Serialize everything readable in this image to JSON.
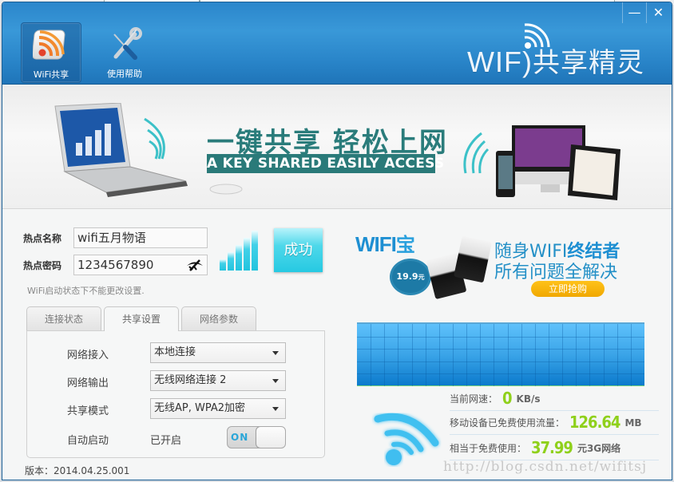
{
  "window": {
    "minimize_label": "—",
    "close_label": "✕"
  },
  "nav": {
    "items": [
      {
        "label": "WiFi共享",
        "icon": "rss-wifi-icon",
        "active": true
      },
      {
        "label": "使用帮助",
        "icon": "tools-icon",
        "active": false
      }
    ]
  },
  "logo": {
    "text_en": "WIF",
    "text_cn": "共享精灵"
  },
  "banner": {
    "slogan_cn": "一键共享 轻松上网",
    "slogan_en": "A KEY SHARED EASILY ACCESS"
  },
  "hotspot": {
    "name_label": "热点名称",
    "name_value": "wifi五月物语",
    "password_label": "热点密码",
    "password_value": "1234567890",
    "hint": "WiFi启动状态下不能更改设置.",
    "status_button": "成功",
    "signal_bars": 5
  },
  "tabs": [
    {
      "label": "连接状态",
      "active": false
    },
    {
      "label": "共享设置",
      "active": true
    },
    {
      "label": "网络参数",
      "active": false
    }
  ],
  "settings": {
    "network_in_label": "网络接入",
    "network_in_value": "本地连接",
    "network_out_label": "网络输出",
    "network_out_value": "无线网络连接 2",
    "share_mode_label": "共享模式",
    "share_mode_value": "无线AP, WPA2加密",
    "autostart_label": "自动启动",
    "autostart_status": "已开启",
    "autostart_toggle": "ON"
  },
  "version": "版本：2014.04.25.001",
  "ad": {
    "brand": "WIFI",
    "brand_suffix": "宝",
    "price": "19.9",
    "price_unit": "元",
    "line1_prefix": "随身WIFI",
    "line1_bold": "终结者",
    "line2": "所有问题全解决",
    "buy_button": "立即抢购"
  },
  "stats": {
    "speed_label": "当前网速：",
    "speed_value": "0",
    "speed_unit": "KB/s",
    "traffic_label": "移动设备已免费使用流量：",
    "traffic_value": "126.64",
    "traffic_unit": "MB",
    "saving_label": "相当于免费使用：",
    "saving_value": "37.99",
    "saving_unit": "元3G网络"
  },
  "watermark": "http://blog.csdn.net/wifitsj",
  "colors": {
    "header_blue": "#2b86cb",
    "accent_cyan": "#26c9e2",
    "stat_green": "#8fd01b",
    "slogan_teal": "#2a7a79"
  }
}
